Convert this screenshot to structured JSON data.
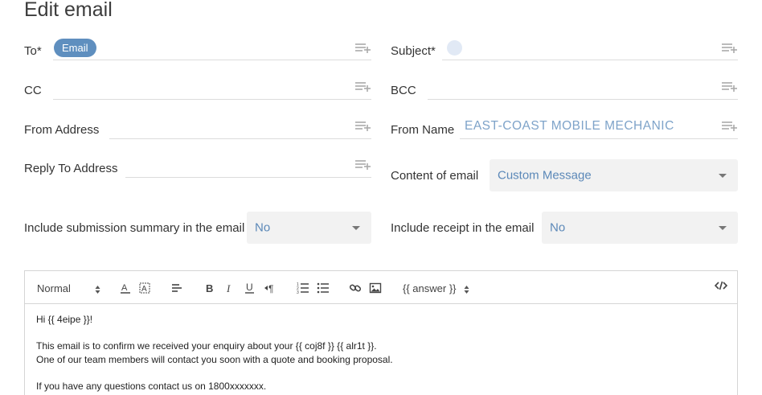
{
  "page": {
    "title": "Edit email"
  },
  "fields": {
    "to_label": "To*",
    "to_chip": "Email",
    "subject_label": "Subject*",
    "cc_label": "CC",
    "bcc_label": "BCC",
    "from_address_label": "From Address",
    "from_name_label": "From Name",
    "from_name_value": "EAST-COAST MOBILE MECHANIC",
    "reply_to_label": "Reply To Address",
    "content_label": "Content of email",
    "content_value": "Custom Message",
    "include_summary_label": "Include submission summary in the email",
    "include_summary_value": "No",
    "include_receipt_label": "Include receipt in the email",
    "include_receipt_value": "No"
  },
  "toolbar": {
    "format": "Normal",
    "answer": "{{ answer }}",
    "icons": [
      "font-color-icon",
      "highlight-icon",
      "align-icon",
      "bold-icon",
      "italic-icon",
      "underline-icon",
      "rtl-paragraph-icon",
      "ordered-list-icon",
      "bullet-list-icon",
      "link-icon",
      "image-icon",
      "source-code-icon"
    ]
  },
  "body": {
    "line1": "Hi {{ 4eipe }}!",
    "line2": "This email is to confirm we received your enquiry about your {{ coj8f }} {{ alr1t }}.",
    "line3": "One of our team members will contact you soon with a quote and booking proposal.",
    "line4": "If you have any questions contact us on 1800xxxxxxx."
  },
  "colors": {
    "chip": "#5f8fbf",
    "link_value": "#5b88b8",
    "from_name": "#7ea3c9",
    "select_bg": "#f2f2f2"
  }
}
